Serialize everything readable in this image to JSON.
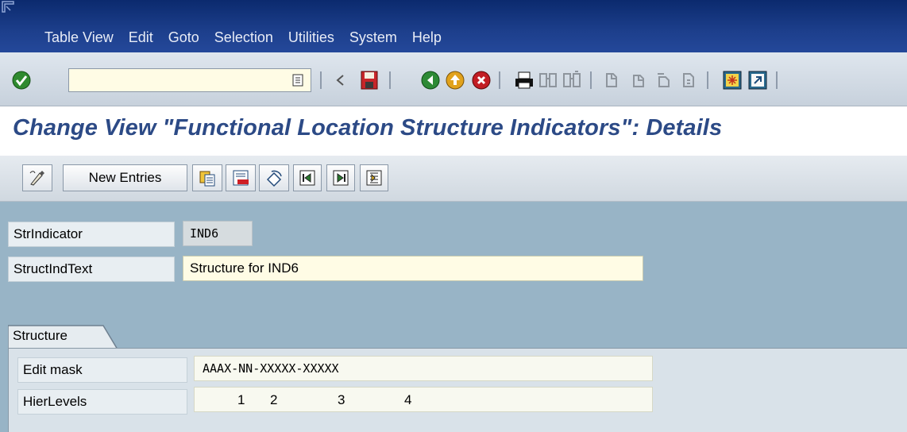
{
  "menubar": {
    "items": [
      "Table View",
      "Edit",
      "Goto",
      "Selection",
      "Utilities",
      "System",
      "Help"
    ]
  },
  "toolbar": {
    "command_field_value": "",
    "icons": [
      "enter-icon",
      "command-dropdown-icon",
      "back-small-icon",
      "save-icon",
      "back-icon",
      "exit-icon",
      "cancel-icon",
      "print-icon",
      "find-icon",
      "find-next-icon",
      "first-page-icon",
      "previous-page-icon",
      "next-page-icon",
      "last-page-icon",
      "create-session-icon",
      "shortcut-icon"
    ]
  },
  "title": "Change View \"Functional Location Structure Indicators\": Details",
  "app_toolbar": {
    "new_entries_label": "New Entries",
    "icons": [
      "display-change-icon",
      "copy-as-icon",
      "delete-icon",
      "undo-change-icon",
      "previous-entry-icon",
      "next-entry-icon",
      "select-all-icon"
    ]
  },
  "fields": {
    "str_indicator": {
      "label": "StrIndicator",
      "value": "IND6"
    },
    "struct_ind_text": {
      "label": "StructIndText",
      "value": "Structure for IND6"
    }
  },
  "structure_group": {
    "title": "Structure",
    "edit_mask": {
      "label": "Edit mask",
      "value": "AAAX-NN-XXXXX-XXXXX"
    },
    "hier_levels": {
      "label": "HierLevels",
      "levels": [
        "1",
        "2",
        "3",
        "4"
      ]
    }
  },
  "colors": {
    "menubar": "#1d3f8c",
    "title": "#2c4a86",
    "content_bg": "#98b4c6",
    "input_bg": "#fffce5"
  }
}
